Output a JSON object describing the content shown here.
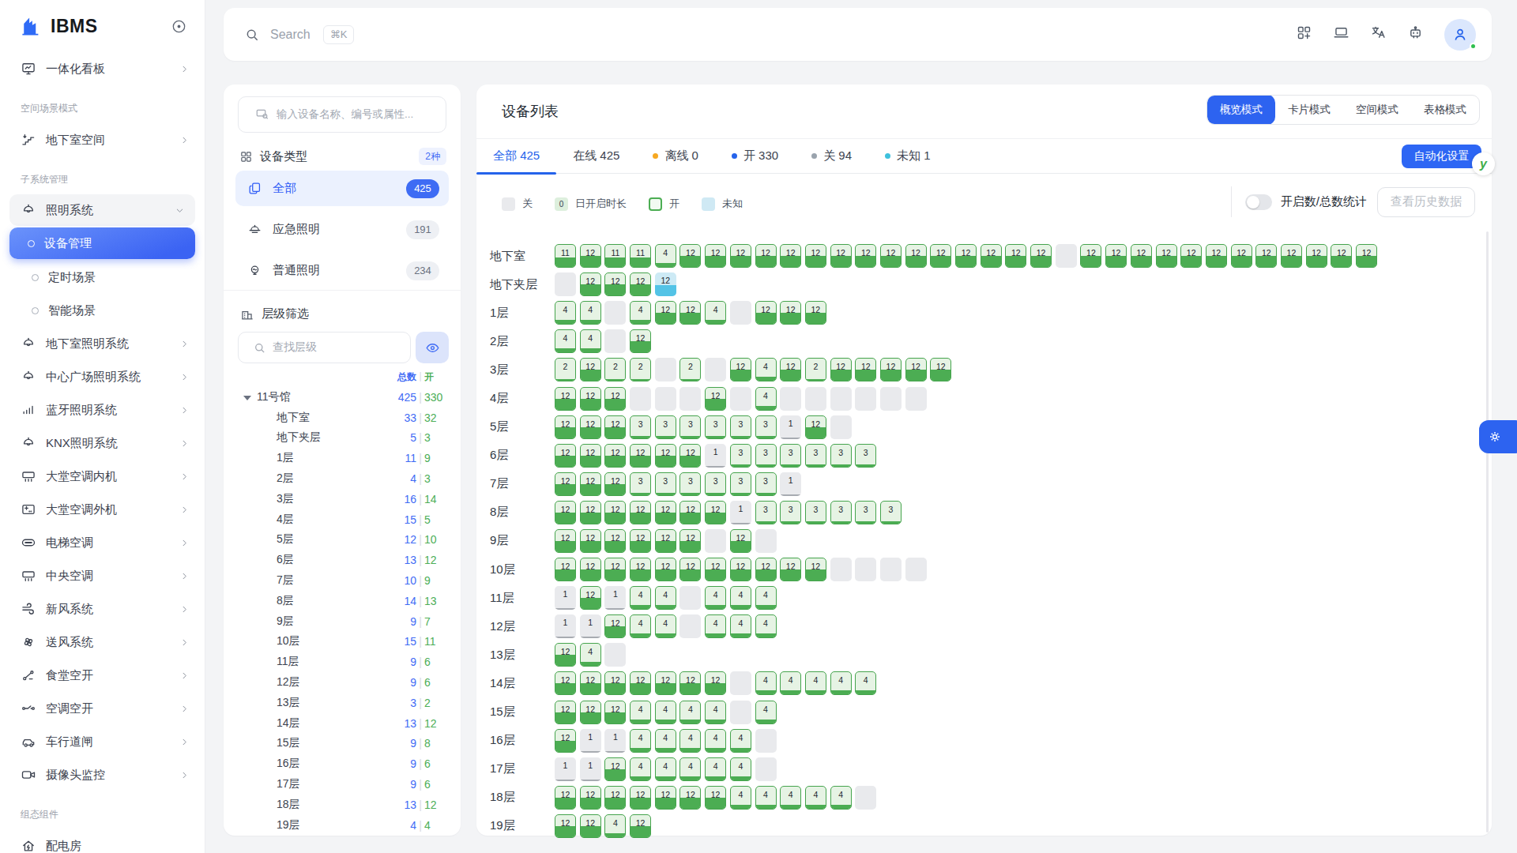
{
  "colors": {
    "accent_blue": "#2d63f0",
    "green_on": "#4cad53",
    "tile_on_bg": "#e6f3e4",
    "tile_off_bg": "#e9eaed",
    "tile_unknown_fill": "#53c3e6",
    "dot_offline": "#f6a821",
    "dot_on": "#2563eb",
    "dot_off": "#9aa3ad",
    "dot_unknown": "#3ec1dd"
  },
  "sidebar": {
    "logo": "IBMS",
    "sections": [
      {
        "label": "",
        "items": [
          {
            "icon": "monitor",
            "label": "一体化看板",
            "chevron": "right"
          }
        ]
      },
      {
        "label": "空间场景模式",
        "items": [
          {
            "icon": "stairs",
            "label": "地下室空间",
            "chevron": "right"
          }
        ]
      },
      {
        "label": "子系统管理",
        "items": [
          {
            "icon": "lamp",
            "label": "照明系统",
            "chevron": "down",
            "style": "expanded"
          },
          {
            "icon": "ring",
            "label": "设备管理",
            "style": "active"
          },
          {
            "icon": "ring",
            "label": "定时场景",
            "style": "child"
          },
          {
            "icon": "ring",
            "label": "智能场景",
            "style": "child"
          },
          {
            "icon": "lamp",
            "label": "地下室照明系统",
            "chevron": "right"
          },
          {
            "icon": "lamp",
            "label": "中心广场照明系统",
            "chevron": "right"
          },
          {
            "icon": "signal",
            "label": "蓝牙照明系统",
            "chevron": "right"
          },
          {
            "icon": "lamp",
            "label": "KNX照明系统",
            "chevron": "right"
          },
          {
            "icon": "ac",
            "label": "大堂空调内机",
            "chevron": "right"
          },
          {
            "icon": "ac-out",
            "label": "大堂空调外机",
            "chevron": "right"
          },
          {
            "icon": "elevator-ac",
            "label": "电梯空调",
            "chevron": "right"
          },
          {
            "icon": "ac",
            "label": "中央空调",
            "chevron": "right"
          },
          {
            "icon": "wind",
            "label": "新风系统",
            "chevron": "right"
          },
          {
            "icon": "fan",
            "label": "送风系统",
            "chevron": "right"
          },
          {
            "icon": "switch",
            "label": "食堂空开",
            "chevron": "right"
          },
          {
            "icon": "switch2",
            "label": "空调空开",
            "chevron": "right"
          },
          {
            "icon": "car",
            "label": "车行道闸",
            "chevron": "right"
          },
          {
            "icon": "camera",
            "label": "摄像头监控",
            "chevron": "right"
          }
        ]
      },
      {
        "label": "组态组件",
        "items": [
          {
            "icon": "house",
            "label": "配电房"
          }
        ]
      }
    ]
  },
  "topbar": {
    "search_placeholder": "Search",
    "search_shortcut": "⌘K",
    "icons": [
      "apps-add",
      "laptop",
      "translate",
      "robot"
    ],
    "avatar_status": "online"
  },
  "filter_panel": {
    "device_search_placeholder": "输入设备名称、编号或属性...",
    "device_type": {
      "title": "设备类型",
      "badge": "2种",
      "items": [
        {
          "icon": "copy",
          "label": "全部",
          "count": "425",
          "active": true
        },
        {
          "icon": "dome",
          "label": "应急照明",
          "count": "191",
          "active": false
        },
        {
          "icon": "bulb",
          "label": "普通照明",
          "count": "234",
          "active": false
        }
      ]
    },
    "level_filter": {
      "title": "层级筛选",
      "search_placeholder": "查找层级",
      "col_total": "总数",
      "col_on": "开",
      "tree": [
        {
          "label": "11号馆",
          "total": "425",
          "on": "330",
          "parent": true
        },
        {
          "label": "地下室",
          "total": "33",
          "on": "32"
        },
        {
          "label": "地下夹层",
          "total": "5",
          "on": "3"
        },
        {
          "label": "1层",
          "total": "11",
          "on": "9"
        },
        {
          "label": "2层",
          "total": "4",
          "on": "3"
        },
        {
          "label": "3层",
          "total": "16",
          "on": "14"
        },
        {
          "label": "4层",
          "total": "15",
          "on": "5"
        },
        {
          "label": "5层",
          "total": "12",
          "on": "10"
        },
        {
          "label": "6层",
          "total": "13",
          "on": "12"
        },
        {
          "label": "7层",
          "total": "10",
          "on": "9"
        },
        {
          "label": "8层",
          "total": "14",
          "on": "13"
        },
        {
          "label": "9层",
          "total": "9",
          "on": "7"
        },
        {
          "label": "10层",
          "total": "15",
          "on": "11"
        },
        {
          "label": "11层",
          "total": "9",
          "on": "6"
        },
        {
          "label": "12层",
          "total": "9",
          "on": "6"
        },
        {
          "label": "13层",
          "total": "3",
          "on": "2"
        },
        {
          "label": "14层",
          "total": "13",
          "on": "12"
        },
        {
          "label": "15层",
          "total": "9",
          "on": "8"
        },
        {
          "label": "16层",
          "total": "9",
          "on": "6"
        },
        {
          "label": "17层",
          "total": "9",
          "on": "6"
        },
        {
          "label": "18层",
          "total": "13",
          "on": "12"
        },
        {
          "label": "19层",
          "total": "4",
          "on": "4"
        }
      ]
    }
  },
  "main": {
    "title": "设备列表",
    "modes": [
      "概览模式",
      "卡片模式",
      "空间模式",
      "表格模式"
    ],
    "active_mode": "概览模式",
    "tabs": [
      {
        "label": "全部",
        "count": "425",
        "active": true
      },
      {
        "label": "在线",
        "count": "425"
      },
      {
        "label": "离线",
        "count": "0",
        "dot": "#f6a821"
      },
      {
        "label": "开",
        "count": "330",
        "dot": "#2563eb"
      },
      {
        "label": "关",
        "count": "94",
        "dot": "#9aa3ad"
      },
      {
        "label": "未知",
        "count": "1",
        "dot": "#3ec1dd"
      }
    ],
    "automation_button": "自动化设置",
    "legend": [
      {
        "type": "off",
        "label": "关",
        "value": ""
      },
      {
        "type": "dur",
        "label": "日开启时长",
        "value": "0"
      },
      {
        "type": "on",
        "label": "开",
        "value": ""
      },
      {
        "type": "unk",
        "label": "未知",
        "value": ""
      }
    ],
    "stats_toggle_label": "开启数/总数统计",
    "history_button": "查看历史数据",
    "grid": {
      "tile_codes": {
        "<n>": "device on, n = hours on today (fill = n/24)",
        "g<n>": "device off, n hours on today",
        "x": "device off",
        "u<n>": "state unknown, n hours"
      },
      "rows": [
        {
          "label": "地下室",
          "tiles": [
            "11",
            "12",
            "11",
            "11",
            "4",
            "12",
            "12",
            "12",
            "12",
            "12",
            "12",
            "12",
            "12",
            "12",
            "12",
            "12",
            "12",
            "12",
            "12",
            "12",
            "x",
            "12",
            "12",
            "12",
            "12",
            "12",
            "12",
            "12",
            "12",
            "12",
            "12",
            "12",
            "12"
          ]
        },
        {
          "label": "地下夹层",
          "tiles": [
            "x",
            "12",
            "12",
            "12",
            "u12"
          ]
        },
        {
          "label": "1层",
          "tiles": [
            "4",
            "4",
            "x",
            "4",
            "12",
            "12",
            "4",
            "x",
            "12",
            "12",
            "12"
          ]
        },
        {
          "label": "2层",
          "tiles": [
            "4",
            "4",
            "x",
            "12"
          ]
        },
        {
          "label": "3层",
          "tiles": [
            "2",
            "12",
            "2",
            "2",
            "x",
            "2",
            "x",
            "12",
            "4",
            "12",
            "2",
            "12",
            "12",
            "12",
            "12",
            "12"
          ]
        },
        {
          "label": "4层",
          "tiles": [
            "12",
            "12",
            "12",
            "x",
            "x",
            "x",
            "12",
            "x",
            "4",
            "x",
            "x",
            "x",
            "x",
            "x",
            "x"
          ]
        },
        {
          "label": "5层",
          "tiles": [
            "12",
            "12",
            "12",
            "3",
            "3",
            "3",
            "3",
            "3",
            "3",
            "g1",
            "12",
            "x"
          ]
        },
        {
          "label": "6层",
          "tiles": [
            "12",
            "12",
            "12",
            "12",
            "12",
            "12",
            "g1",
            "3",
            "3",
            "3",
            "3",
            "3",
            "3"
          ]
        },
        {
          "label": "7层",
          "tiles": [
            "12",
            "12",
            "12",
            "3",
            "3",
            "3",
            "3",
            "3",
            "3",
            "g1"
          ]
        },
        {
          "label": "8层",
          "tiles": [
            "12",
            "12",
            "12",
            "12",
            "12",
            "12",
            "12",
            "g1",
            "3",
            "3",
            "3",
            "3",
            "3",
            "3"
          ]
        },
        {
          "label": "9层",
          "tiles": [
            "12",
            "12",
            "12",
            "12",
            "12",
            "12",
            "x",
            "12",
            "x"
          ]
        },
        {
          "label": "10层",
          "tiles": [
            "12",
            "12",
            "12",
            "12",
            "12",
            "12",
            "12",
            "12",
            "12",
            "12",
            "12",
            "x",
            "x",
            "x",
            "x"
          ]
        },
        {
          "label": "11层",
          "tiles": [
            "g1",
            "12",
            "g1",
            "4",
            "4",
            "x",
            "4",
            "4",
            "4"
          ]
        },
        {
          "label": "12层",
          "tiles": [
            "g1",
            "g1",
            "12",
            "4",
            "4",
            "x",
            "4",
            "4",
            "4"
          ]
        },
        {
          "label": "13层",
          "tiles": [
            "12",
            "4",
            "x"
          ]
        },
        {
          "label": "14层",
          "tiles": [
            "12",
            "12",
            "12",
            "12",
            "12",
            "12",
            "12",
            "x",
            "4",
            "4",
            "4",
            "4",
            "4"
          ]
        },
        {
          "label": "15层",
          "tiles": [
            "12",
            "12",
            "12",
            "4",
            "4",
            "4",
            "4",
            "x",
            "4"
          ]
        },
        {
          "label": "16层",
          "tiles": [
            "12",
            "g1",
            "g1",
            "4",
            "4",
            "4",
            "4",
            "4",
            "x"
          ]
        },
        {
          "label": "17层",
          "tiles": [
            "g1",
            "g1",
            "12",
            "4",
            "4",
            "4",
            "4",
            "4",
            "x"
          ]
        },
        {
          "label": "18层",
          "tiles": [
            "12",
            "12",
            "12",
            "12",
            "12",
            "12",
            "12",
            "4",
            "4",
            "4",
            "4",
            "4",
            "x"
          ]
        },
        {
          "label": "19层",
          "tiles": [
            "12",
            "12",
            "4",
            "12"
          ]
        }
      ]
    }
  }
}
